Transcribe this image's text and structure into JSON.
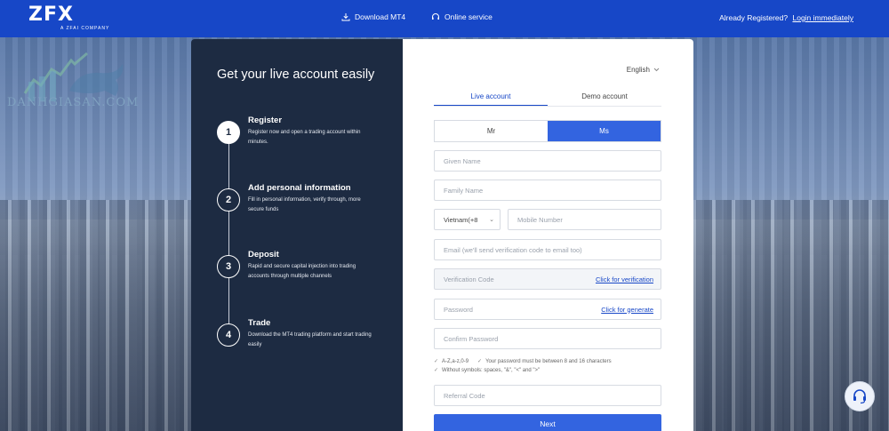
{
  "header": {
    "logo_text": "ZFX",
    "logo_sub": "A ZFAI COMPANY",
    "download_label": "Download MT4",
    "online_service_label": "Online service",
    "already_registered": "Already Registered?",
    "login_label": "Login immediately"
  },
  "watermark": {
    "text": "DANHGIASAN.COM"
  },
  "steps": {
    "heading": "Get your live account easily",
    "items": [
      {
        "num": "1",
        "title": "Register",
        "desc": "Register now and open a trading account within minutes."
      },
      {
        "num": "2",
        "title": "Add personal information",
        "desc": "Fill in personal information, verify through, more secure funds"
      },
      {
        "num": "3",
        "title": "Deposit",
        "desc": "Rapid and secure capital injection into trading accounts through multiple channels"
      },
      {
        "num": "4",
        "title": "Trade",
        "desc": "Download the MT4 trading platform and start trading easily"
      }
    ]
  },
  "form": {
    "language": "English",
    "tabs": [
      {
        "label": "Live account",
        "active": true
      },
      {
        "label": "Demo account",
        "active": false
      }
    ],
    "salutation": {
      "options": [
        "Mr",
        "Ms"
      ],
      "selected": "Ms"
    },
    "given_name_placeholder": "Given Name",
    "family_name_placeholder": "Family Name",
    "country_code": "Vietnam(+8",
    "mobile_placeholder": "Mobile Number",
    "email_placeholder": "Email (we'll send verification code to email too)",
    "verification_placeholder": "Verification Code",
    "verification_action": "Click for verification",
    "password_placeholder": "Password",
    "password_action": "Click for generate",
    "confirm_password_placeholder": "Confirm Password",
    "hints": {
      "charset": "A-Z,a-z,0-9",
      "length": "Your password must be between 8 and 16 characters",
      "symbols": "Without symbols: spaces, \"&\", \"<\" and \">\""
    },
    "referral_placeholder": "Referral Code",
    "next_label": "Next"
  },
  "colors": {
    "brand_blue": "#1747c7",
    "button_blue": "#3364e0",
    "dark_panel": "#1d2b42"
  }
}
